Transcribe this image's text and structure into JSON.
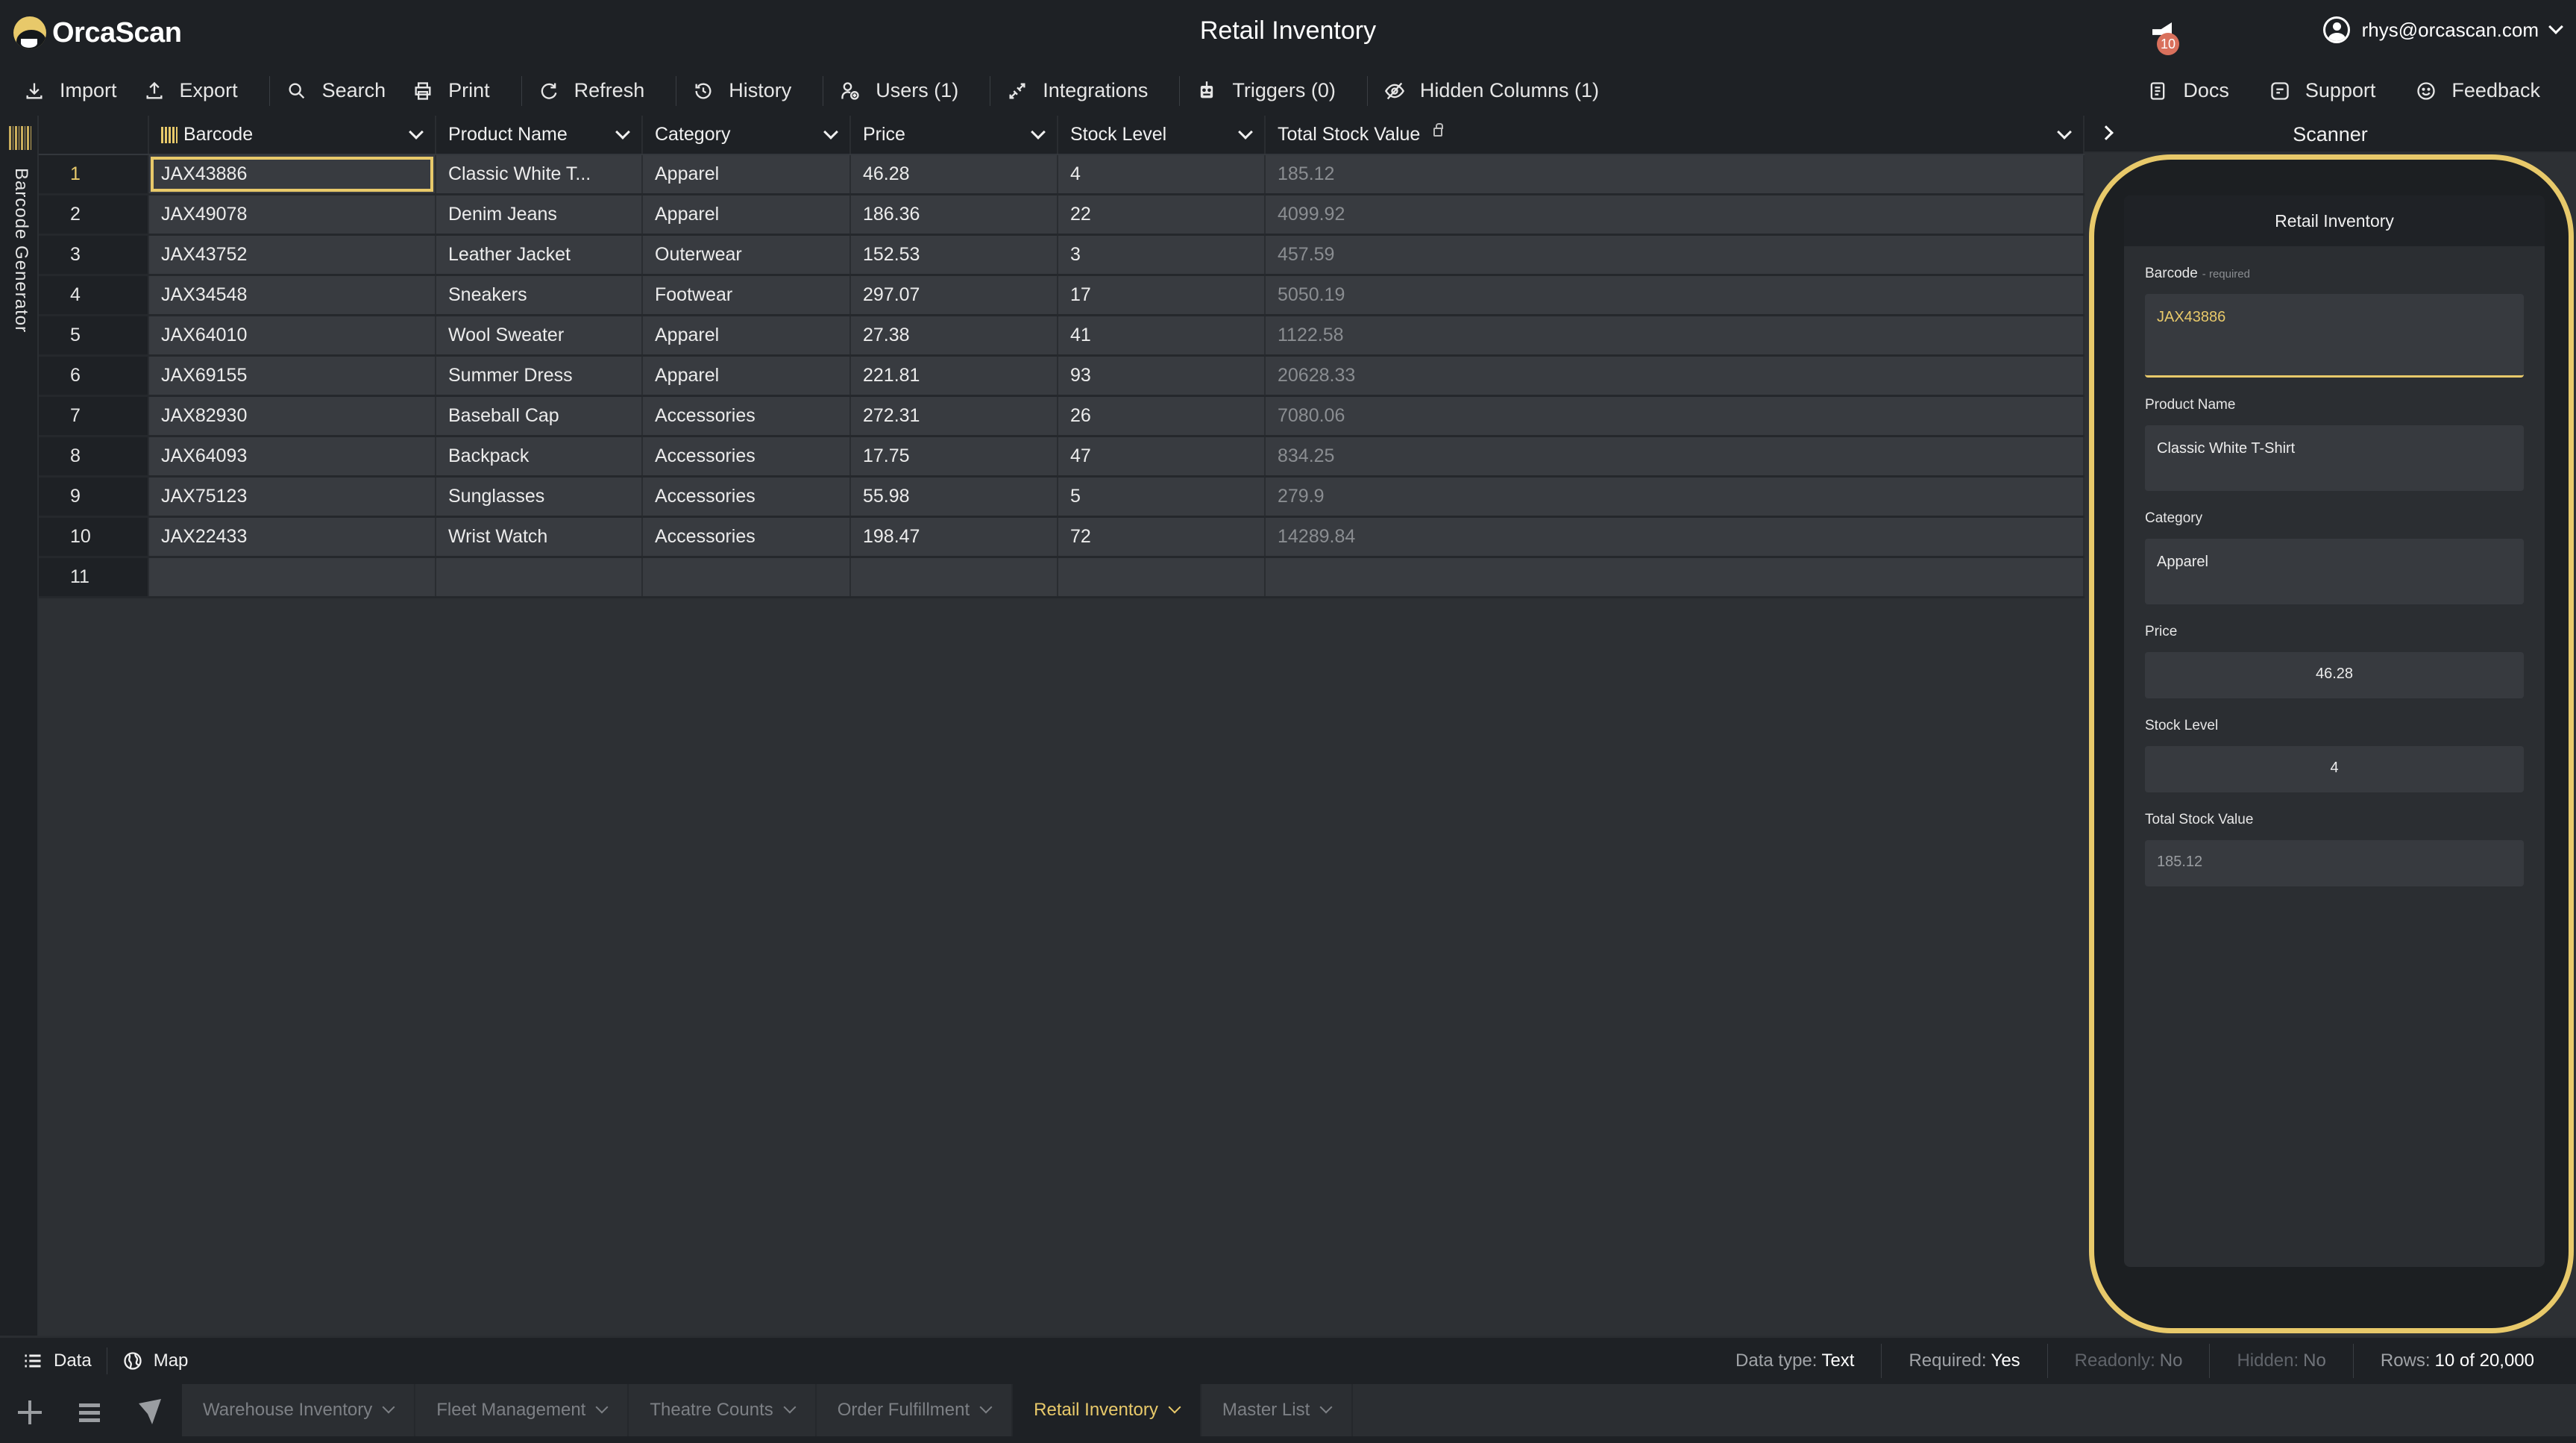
{
  "header": {
    "logo_text": "OrcaScan",
    "title": "Retail Inventory",
    "notifications_count": "10",
    "user_email": "rhys@orcascan.com"
  },
  "toolbar": {
    "items": [
      {
        "label": "Import",
        "icon": "download-icon"
      },
      {
        "label": "Export",
        "icon": "upload-icon"
      },
      {
        "label": "Search",
        "icon": "search-icon"
      },
      {
        "label": "Print",
        "icon": "print-icon"
      },
      {
        "label": "Refresh",
        "icon": "refresh-icon"
      },
      {
        "label": "History",
        "icon": "history-icon"
      },
      {
        "label": "Users (1)",
        "icon": "users-icon"
      },
      {
        "label": "Integrations",
        "icon": "integrations-icon"
      },
      {
        "label": "Triggers (0)",
        "icon": "robot-icon"
      },
      {
        "label": "Hidden Columns (1)",
        "icon": "eye-off-icon"
      }
    ],
    "right_items": [
      {
        "label": "Docs",
        "icon": "docs-icon"
      },
      {
        "label": "Support",
        "icon": "support-icon"
      },
      {
        "label": "Feedback",
        "icon": "smiley-icon"
      }
    ]
  },
  "left_strip": {
    "label": "Barcode Generator"
  },
  "grid": {
    "columns": [
      "Barcode",
      "Product Name",
      "Category",
      "Price",
      "Stock Level",
      "Total Stock Value"
    ],
    "rows": [
      {
        "num": "1",
        "barcode": "JAX43886",
        "name": "Classic White T...",
        "category": "Apparel",
        "price": "46.28",
        "stock": "4",
        "total": "185.12"
      },
      {
        "num": "2",
        "barcode": "JAX49078",
        "name": "Denim Jeans",
        "category": "Apparel",
        "price": "186.36",
        "stock": "22",
        "total": "4099.92"
      },
      {
        "num": "3",
        "barcode": "JAX43752",
        "name": "Leather Jacket",
        "category": "Outerwear",
        "price": "152.53",
        "stock": "3",
        "total": "457.59"
      },
      {
        "num": "4",
        "barcode": "JAX34548",
        "name": "Sneakers",
        "category": "Footwear",
        "price": "297.07",
        "stock": "17",
        "total": "5050.19"
      },
      {
        "num": "5",
        "barcode": "JAX64010",
        "name": "Wool Sweater",
        "category": "Apparel",
        "price": "27.38",
        "stock": "41",
        "total": "1122.58"
      },
      {
        "num": "6",
        "barcode": "JAX69155",
        "name": "Summer Dress",
        "category": "Apparel",
        "price": "221.81",
        "stock": "93",
        "total": "20628.33"
      },
      {
        "num": "7",
        "barcode": "JAX82930",
        "name": "Baseball Cap",
        "category": "Accessories",
        "price": "272.31",
        "stock": "26",
        "total": "7080.06"
      },
      {
        "num": "8",
        "barcode": "JAX64093",
        "name": "Backpack",
        "category": "Accessories",
        "price": "17.75",
        "stock": "47",
        "total": "834.25"
      },
      {
        "num": "9",
        "barcode": "JAX75123",
        "name": "Sunglasses",
        "category": "Accessories",
        "price": "55.98",
        "stock": "5",
        "total": "279.9"
      },
      {
        "num": "10",
        "barcode": "JAX22433",
        "name": "Wrist Watch",
        "category": "Accessories",
        "price": "198.47",
        "stock": "72",
        "total": "14289.84"
      },
      {
        "num": "11",
        "barcode": "",
        "name": "",
        "category": "",
        "price": "",
        "stock": "",
        "total": ""
      }
    ]
  },
  "scanner": {
    "panel_title": "Scanner",
    "form_title": "Retail Inventory",
    "required_label": "- required",
    "fields": [
      {
        "label": "Barcode",
        "value": "JAX43886"
      },
      {
        "label": "Product Name",
        "value": "Classic White T-Shirt"
      },
      {
        "label": "Category",
        "value": "Apparel"
      },
      {
        "label": "Price",
        "value": "46.28"
      },
      {
        "label": "Stock Level",
        "value": "4"
      },
      {
        "label": "Total Stock Value",
        "value": "185.12"
      }
    ]
  },
  "statusbar": {
    "views": [
      {
        "label": "Data"
      },
      {
        "label": "Map"
      }
    ],
    "data_type_label": "Data type:",
    "data_type_value": "Text",
    "required_label": "Required:",
    "required_value": "Yes",
    "readonly_label": "Readonly:",
    "readonly_value": "No",
    "hidden_label": "Hidden:",
    "hidden_value": "No",
    "rows_label": "Rows:",
    "rows_value": "10 of 20,000"
  },
  "sheet_tabs": [
    {
      "label": "Warehouse Inventory",
      "active": false
    },
    {
      "label": "Fleet Management",
      "active": false
    },
    {
      "label": "Theatre Counts",
      "active": false
    },
    {
      "label": "Order Fulfillment",
      "active": false
    },
    {
      "label": "Retail Inventory",
      "active": true
    },
    {
      "label": "Master List",
      "active": false
    }
  ],
  "colors": {
    "accent": "#e8c96a",
    "background": "#1e2125",
    "cell": "#383b40",
    "badge": "#d9705c"
  }
}
